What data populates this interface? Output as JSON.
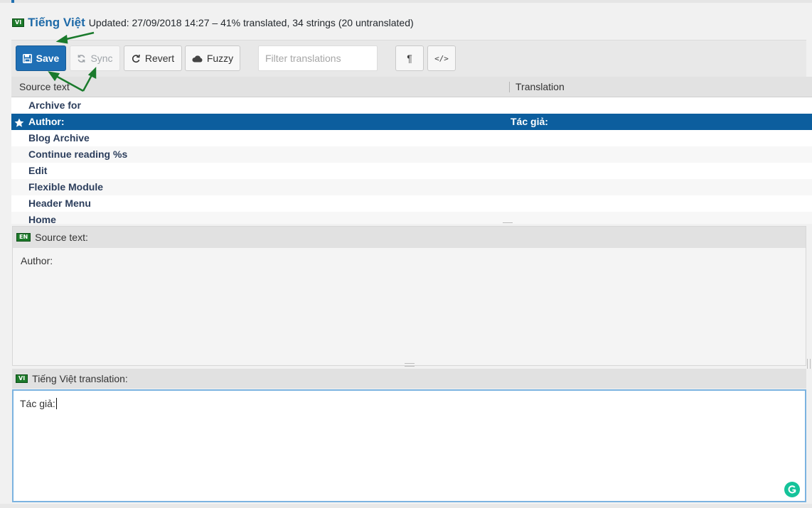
{
  "header": {
    "lang_code": "VI",
    "lang_name": "Tiếng Việt",
    "status": "Updated: 27/09/2018 14:27 – 41% translated, 34 strings (20 untranslated)"
  },
  "toolbar": {
    "save_label": "Save",
    "sync_label": "Sync",
    "revert_label": "Revert",
    "fuzzy_label": "Fuzzy",
    "filter_placeholder": "Filter translations",
    "filter_value": "",
    "pilcrow_label": "¶",
    "code_label": "</>"
  },
  "grid": {
    "source_header": "Source text",
    "translation_header": "Translation",
    "rows": [
      {
        "source": "Archive for",
        "translation": ""
      },
      {
        "source": "Author:",
        "translation": "Tác giả:",
        "selected": true,
        "starred": true
      },
      {
        "source": "Blog Archive",
        "translation": ""
      },
      {
        "source": "Continue reading %s",
        "translation": ""
      },
      {
        "source": "Edit",
        "translation": ""
      },
      {
        "source": "Flexible Module",
        "translation": ""
      },
      {
        "source": "Header Menu",
        "translation": ""
      },
      {
        "source": "Home",
        "translation": ""
      }
    ]
  },
  "source_panel": {
    "lang_code": "EN",
    "label": "Source text:",
    "text": "Author:"
  },
  "translation_panel": {
    "lang_code": "VI",
    "label": "Tiếng Việt translation:",
    "text": "Tác giả:"
  },
  "icons": {
    "save": "floppy-disk-icon",
    "sync": "refresh-icon",
    "revert": "undo-icon",
    "fuzzy": "cloud-icon",
    "star": "star-icon",
    "grammarly": "grammarly-icon"
  },
  "colors": {
    "accent": "#1f6fb5",
    "selected_row": "#0c5e9e",
    "flag_green": "#1d7a2a",
    "annotation_arrow": "#1a7a2c",
    "grammarly": "#15c39a"
  }
}
